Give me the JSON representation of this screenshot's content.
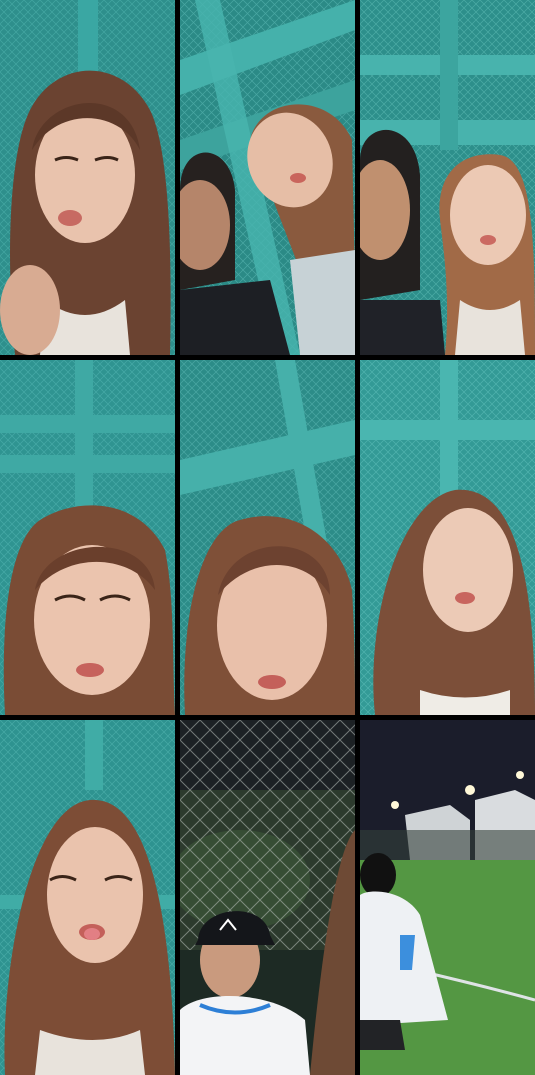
{
  "tiles": [
    {
      "id": 1,
      "scene": "fence-selfie",
      "subject": "girl",
      "palette": {
        "bg": "#2e8f8c",
        "beam": "#3aa7a3",
        "hair": "#6b4331",
        "skin": "#e9c3ad",
        "cloth": "#e8e3dc"
      }
    },
    {
      "id": 2,
      "scene": "fence-low-angle",
      "subject": "girl-and-boy",
      "palette": {
        "bg": "#2b8a86",
        "beam": "#45b1ab",
        "hair": "#8a5a3e",
        "skin": "#e6bea6",
        "cloth": "#1d1f24"
      }
    },
    {
      "id": 3,
      "scene": "fence-duo",
      "subject": "girl-and-boy",
      "palette": {
        "bg": "#2d8f8b",
        "beam": "#48b3ad",
        "hair": "#a16a47",
        "skin": "#ecc9b4",
        "cloth": "#202228"
      }
    },
    {
      "id": 4,
      "scene": "fence-selfie",
      "subject": "girl",
      "palette": {
        "bg": "#2f9491",
        "beam": "#3fa9a4",
        "hair": "#7a4c35",
        "skin": "#ebc4ae",
        "cloth": "#e8e3dc"
      }
    },
    {
      "id": 5,
      "scene": "fence-selfie",
      "subject": "girl",
      "palette": {
        "bg": "#2c8c88",
        "beam": "#46b0aa",
        "hair": "#7f5038",
        "skin": "#e9c0aa",
        "cloth": "#e8e3dc"
      }
    },
    {
      "id": 6,
      "scene": "fence-selfie",
      "subject": "girl",
      "palette": {
        "bg": "#339a96",
        "beam": "#4ab6b0",
        "hair": "#7c4f39",
        "skin": "#eccab6",
        "cloth": "#efece6"
      }
    },
    {
      "id": 7,
      "scene": "fence-selfie",
      "subject": "girl",
      "palette": {
        "bg": "#2e9390",
        "beam": "#40aca6",
        "hair": "#7d4d36",
        "skin": "#eac3ad",
        "cloth": "#e8e3dc"
      }
    },
    {
      "id": 8,
      "scene": "night-net",
      "subject": "boy-with-cap",
      "palette": {
        "bg": "#1c2124",
        "beam": "#9ea6a0",
        "hair": "#111",
        "skin": "#c99a7e",
        "cloth": "#f3f4f6"
      }
    },
    {
      "id": 9,
      "scene": "night-field",
      "subject": "boy-back",
      "palette": {
        "bg": "#1b1d2b",
        "beam": "#dfe3e6",
        "hair": "#111",
        "skin": "#b68a6a",
        "cloth": "#eef1f4"
      }
    }
  ]
}
